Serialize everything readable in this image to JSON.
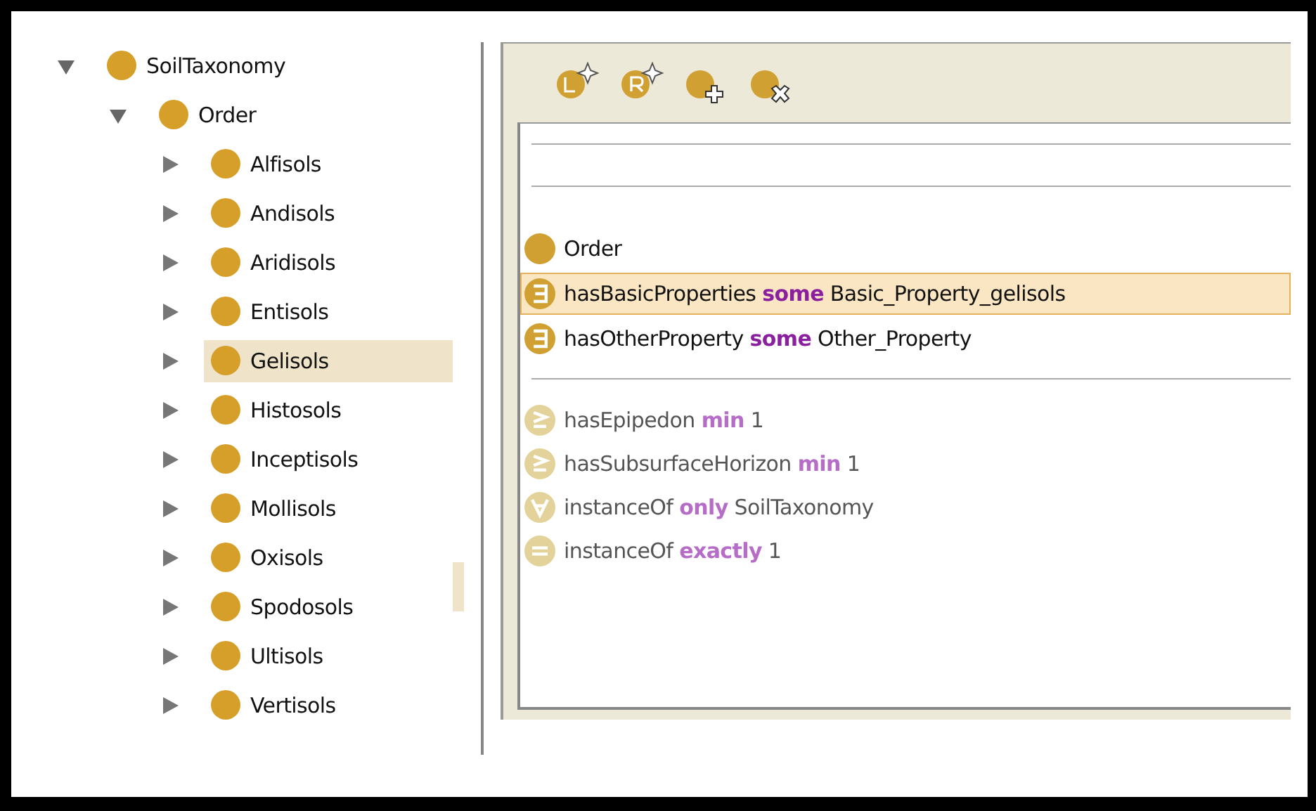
{
  "tree": [
    {
      "label": "SoilTaxonomy",
      "expanded": true,
      "selected": false,
      "children": [
        {
          "label": "Order",
          "expanded": true,
          "selected": false,
          "children": [
            {
              "label": "Alfisols",
              "expanded": false,
              "selected": false
            },
            {
              "label": "Andisols",
              "expanded": false,
              "selected": false
            },
            {
              "label": "Aridisols",
              "expanded": false,
              "selected": false
            },
            {
              "label": "Entisols",
              "expanded": false,
              "selected": false
            },
            {
              "label": "Gelisols",
              "expanded": false,
              "selected": true
            },
            {
              "label": "Histosols",
              "expanded": false,
              "selected": false
            },
            {
              "label": "Inceptisols",
              "expanded": false,
              "selected": false
            },
            {
              "label": "Mollisols",
              "expanded": false,
              "selected": false
            },
            {
              "label": "Oxisols",
              "expanded": false,
              "selected": false
            },
            {
              "label": "Spodosols",
              "expanded": false,
              "selected": false
            },
            {
              "label": "Ultisols",
              "expanded": false,
              "selected": false
            },
            {
              "label": "Vertisols",
              "expanded": false,
              "selected": false
            }
          ]
        }
      ]
    }
  ],
  "toolbar": [
    {
      "kind": "add-class-l"
    },
    {
      "kind": "add-class-r"
    },
    {
      "kind": "add-class"
    },
    {
      "kind": "delete-class"
    }
  ],
  "asserted": [
    {
      "kind": "class",
      "text": "Order",
      "selected": false
    },
    {
      "kind": "some",
      "text": "hasBasicProperties **some** Basic_Property_gelisols",
      "selected": true
    },
    {
      "kind": "some",
      "text": "hasOtherProperty **some** Other_Property",
      "selected": false
    }
  ],
  "inherited": [
    {
      "kind": "min",
      "text": "hasEpipedon **min** 1",
      "selected": false
    },
    {
      "kind": "min",
      "text": "hasSubsurfaceHorizon **min** 1",
      "selected": false
    },
    {
      "kind": "only",
      "text": "instanceOf **only** SoilTaxonomy",
      "selected": false
    },
    {
      "kind": "exactly",
      "text": "instanceOf **exactly** 1",
      "selected": false
    }
  ]
}
